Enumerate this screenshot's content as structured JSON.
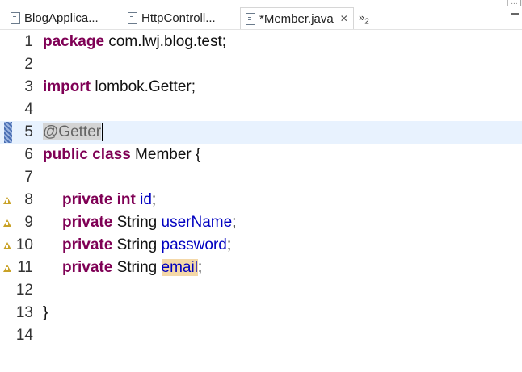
{
  "tabs": [
    {
      "label": "BlogApplica...",
      "active": false
    },
    {
      "label": "HttpControll...",
      "active": false
    },
    {
      "label": "*Member.java",
      "active": true
    }
  ],
  "tab_overflow": {
    "symbol": "»",
    "count": "2"
  },
  "active_tab_close": "✕",
  "top_fragment": "| ... |",
  "editor": {
    "line_numbers": [
      "1",
      "2",
      "3",
      "4",
      "5",
      "6",
      "7",
      "8",
      "9",
      "10",
      "11",
      "12",
      "13",
      "14"
    ],
    "lines": {
      "l1_kw": "package",
      "l1_rest": " com.lwj.blog.test;",
      "l3_kw": "import",
      "l3_rest": " lombok.Getter;",
      "l5_ann": "@Getter",
      "l6_kw": "public class",
      "l6_rest": " Member {",
      "l8_kw": "private int",
      "l8_field": "id",
      "l8_end": ";",
      "l9_kw": "private",
      "l9_type": " String ",
      "l9_field": "userName",
      "l9_end": ";",
      "l10_kw": "private",
      "l10_type": " String ",
      "l10_field": "password",
      "l10_end": ";",
      "l11_kw": "private",
      "l11_type": " String ",
      "l11_field": "email",
      "l11_end": ";",
      "l13": "}"
    },
    "current_line": 5,
    "warning_lines": [
      8,
      9,
      10,
      11
    ]
  },
  "colors": {
    "keyword": "#7f0055",
    "field": "#0000c0",
    "annotation": "#646464",
    "current_line_bg": "#e8f2fe",
    "highlight_bg": "#f4d8a8"
  }
}
